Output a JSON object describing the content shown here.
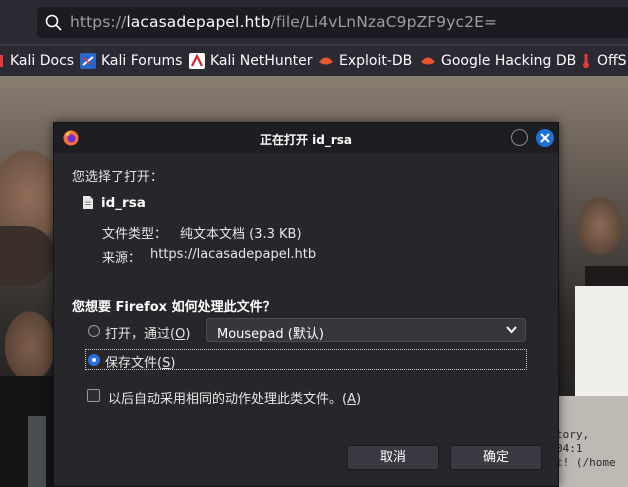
{
  "browser": {
    "url_prefix": "https://",
    "url_host": "lacasadepapel.htb",
    "url_path": "/file/Li4vLnNzaC9pZF9yc2E=",
    "bookmarks": [
      {
        "label": "Kali Docs",
        "icon": "kali-dragon-icon"
      },
      {
        "label": "Kali Forums",
        "icon": "kali-forums-icon"
      },
      {
        "label": "Kali NetHunter",
        "icon": "nethunter-icon"
      },
      {
        "label": "Exploit-DB",
        "icon": "exploitdb-icon"
      },
      {
        "label": "Google Hacking DB",
        "icon": "ghdb-icon"
      },
      {
        "label": "OffS",
        "icon": "offsec-icon"
      }
    ]
  },
  "background_terminal": {
    "line1": "tory,",
    "line2": "04:1",
    "line3": "t! (/home"
  },
  "dialog": {
    "title": "正在打开 id_rsa",
    "chosen_label": "您选择了打开：",
    "file_name": "id_rsa",
    "file_type_label": "文件类型：",
    "file_type_value": "纯文本文档 (3.3 KB)",
    "source_label": "来源：",
    "source_value": "https://lacasadepapel.htb",
    "question": "您想要 Firefox 如何处理此文件？",
    "open_with_prefix": "打开，通过(",
    "open_with_key": "O",
    "open_with_suffix": ")",
    "open_with_app": "Mousepad (默认)",
    "save_prefix": "保存文件(",
    "save_key": "S",
    "save_suffix": ")",
    "selected_option": "save",
    "auto_prefix": "以后自动采用相同的动作处理此类文件。(",
    "auto_key": "A",
    "auto_suffix": ")",
    "auto_checked": false,
    "cancel_label": "取消",
    "ok_label": "确定"
  },
  "colors": {
    "accent": "#2b6ee0",
    "close_button": "#1d71d6",
    "dialog_bg": "#26262b"
  }
}
